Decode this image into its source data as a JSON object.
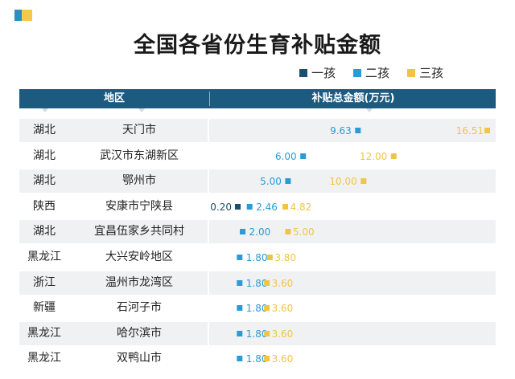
{
  "title": "全国各省份生育补贴金额",
  "legend": [
    {
      "label": "一孩",
      "color": "#1c4e6e"
    },
    {
      "label": "二孩",
      "color": "#2a9bd6"
    },
    {
      "label": "三孩",
      "color": "#f0c544"
    }
  ],
  "header": {
    "region": "地区",
    "amount": "补贴总金额(万元)"
  },
  "chart_data": {
    "type": "scatter",
    "title": "全国各省份生育补贴金额",
    "series_names": [
      "一孩",
      "二孩",
      "三孩"
    ],
    "rows": [
      {
        "province": "湖北",
        "city": "天门市",
        "first": null,
        "second": "9.63",
        "third": "16.51"
      },
      {
        "province": "湖北",
        "city": "武汉市东湖新区",
        "first": null,
        "second": "6.00",
        "third": "12.00"
      },
      {
        "province": "湖北",
        "city": "鄂州市",
        "first": null,
        "second": "5.00",
        "third": "10.00"
      },
      {
        "province": "陕西",
        "city": "安康市宁陕县",
        "first": "0.20",
        "second": "2.46",
        "third": "4.82"
      },
      {
        "province": "湖北",
        "city": "宜昌伍家乡共同村",
        "first": null,
        "second": "2.00",
        "third": "5.00"
      },
      {
        "province": "黑龙江",
        "city": "大兴安岭地区",
        "first": null,
        "second": "1.80",
        "third": "3.80"
      },
      {
        "province": "浙江",
        "city": "温州市龙湾区",
        "first": null,
        "second": "1.80",
        "third": "3.60"
      },
      {
        "province": "新疆",
        "city": "石河子市",
        "first": null,
        "second": "1.80",
        "third": "3.60"
      },
      {
        "province": "黑龙江",
        "city": "哈尔滨市",
        "first": null,
        "second": "1.80",
        "third": "3.60"
      },
      {
        "province": "黑龙江",
        "city": "双鸭山市",
        "first": null,
        "second": "1.80",
        "third": "3.60"
      }
    ]
  }
}
